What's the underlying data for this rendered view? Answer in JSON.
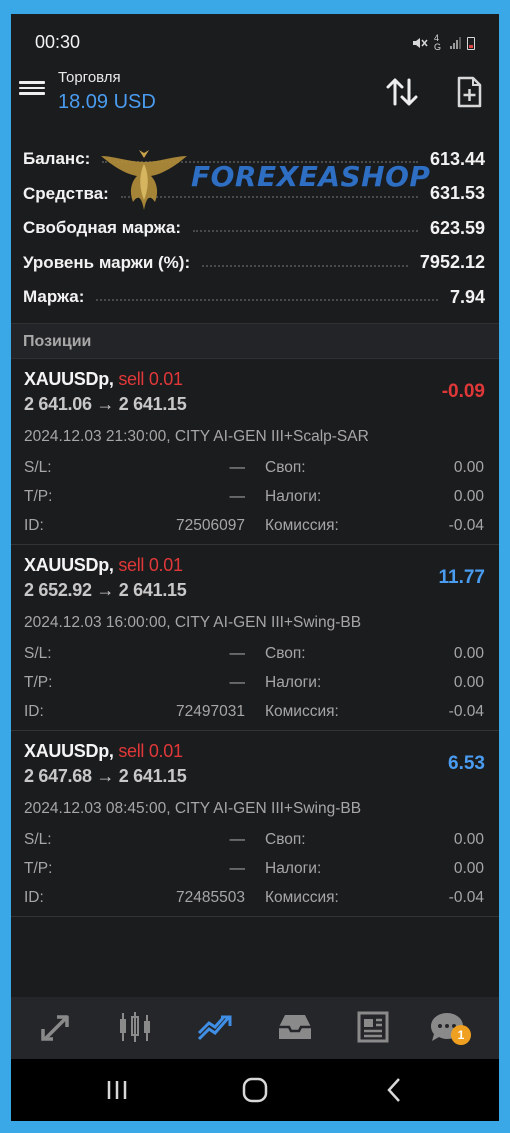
{
  "status_bar": {
    "time": "00:30",
    "network": "4G",
    "icons": [
      "mute-icon",
      "network-4g-icon",
      "signal-icon",
      "battery-low-icon"
    ]
  },
  "toolbar": {
    "title": "Торговля",
    "balance": "18.09 USD",
    "icons": [
      "menu-icon",
      "sort-icon",
      "new-order-icon"
    ]
  },
  "summary": [
    {
      "label": "Баланс:",
      "value": "613.44"
    },
    {
      "label": "Средства:",
      "value": "631.53"
    },
    {
      "label": "Свободная маржа:",
      "value": "623.59"
    },
    {
      "label": "Уровень маржи (%):",
      "value": "7952.12"
    },
    {
      "label": "Маржа:",
      "value": "7.94"
    }
  ],
  "watermark": {
    "text": "FOREXEASHOP"
  },
  "positions_header": "Позиции",
  "positions": [
    {
      "symbol": "XAUUSDp,",
      "side": "sell 0.01",
      "prices": "2 641.06 → 2 641.15",
      "profit": "-0.09",
      "comment": "2024.12.03 21:30:00, CITY AI-GEN III+Scalp-SAR",
      "sl_label": "S/L:",
      "sl": "—",
      "tp_label": "T/P:",
      "tp": "—",
      "id_label": "ID:",
      "id": "72506097",
      "swap_label": "Своп:",
      "swap": "0.00",
      "tax_label": "Налоги:",
      "tax": "0.00",
      "commission_label": "Комиссия:",
      "commission": "-0.04"
    },
    {
      "symbol": "XAUUSDp,",
      "side": "sell 0.01",
      "prices": "2 652.92 → 2 641.15",
      "profit": "11.77",
      "comment": "2024.12.03 16:00:00, CITY AI-GEN III+Swing-BB",
      "sl_label": "S/L:",
      "sl": "—",
      "tp_label": "T/P:",
      "tp": "—",
      "id_label": "ID:",
      "id": "72497031",
      "swap_label": "Своп:",
      "swap": "0.00",
      "tax_label": "Налоги:",
      "tax": "0.00",
      "commission_label": "Комиссия:",
      "commission": "-0.04"
    },
    {
      "symbol": "XAUUSDp,",
      "side": "sell 0.01",
      "prices": "2 647.68 → 2 641.15",
      "profit": "6.53",
      "comment": "2024.12.03 08:45:00, CITY AI-GEN III+Swing-BB",
      "sl_label": "S/L:",
      "sl": "—",
      "tp_label": "T/P:",
      "tp": "—",
      "id_label": "ID:",
      "id": "72485503",
      "swap_label": "Своп:",
      "swap": "0.00",
      "tax_label": "Налоги:",
      "tax": "0.00",
      "commission_label": "Комиссия:",
      "commission": "-0.04"
    }
  ],
  "bottom_nav": {
    "items": [
      "quotes-icon",
      "chart-icon",
      "trade-icon",
      "history-icon",
      "news-icon",
      "messages-icon"
    ],
    "active": "trade-icon",
    "badge": "1"
  },
  "system_nav": [
    "recents-icon",
    "home-icon",
    "back-icon"
  ],
  "colors": {
    "accent": "#4a9cf0",
    "loss": "#e03838",
    "background": "#1b1c1e",
    "frame": "#3aa7e6"
  }
}
